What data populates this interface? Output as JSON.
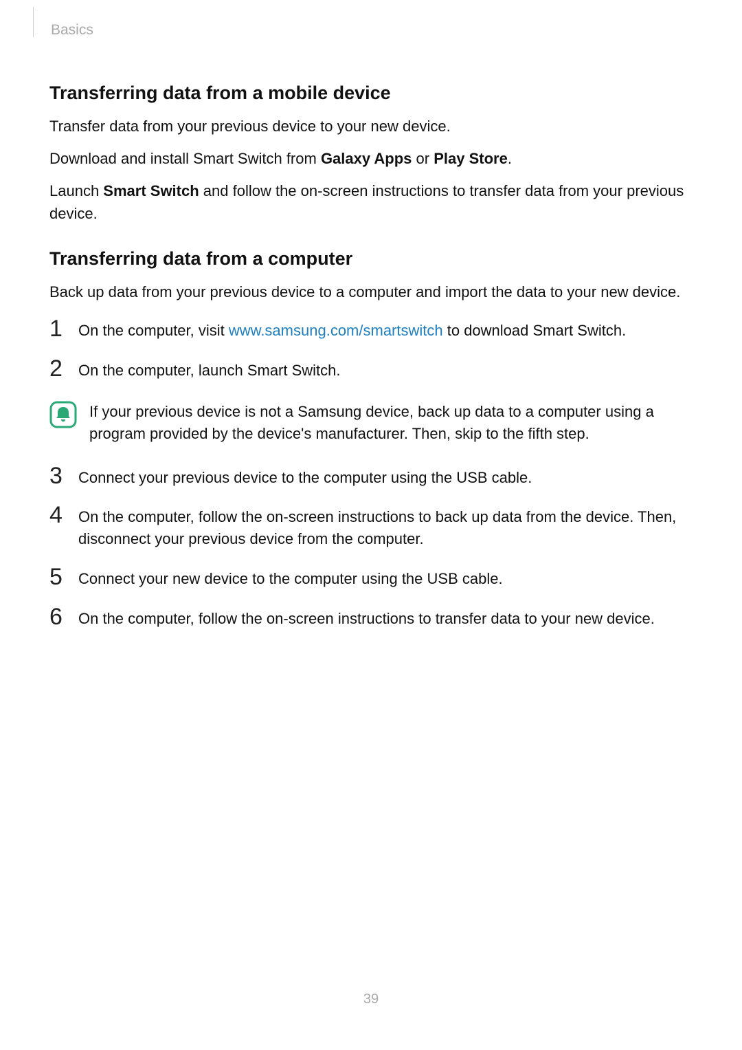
{
  "header": {
    "chapter": "Basics"
  },
  "section1": {
    "title": "Transferring data from a mobile device",
    "p1": "Transfer data from your previous device to your new device.",
    "p2_a": "Download and install Smart Switch from ",
    "p2_b": "Galaxy Apps",
    "p2_c": " or ",
    "p2_d": "Play Store",
    "p2_e": ".",
    "p3_a": "Launch ",
    "p3_b": "Smart Switch",
    "p3_c": " and follow the on-screen instructions to transfer data from your previous device."
  },
  "section2": {
    "title": "Transferring data from a computer",
    "intro": "Back up data from your previous device to a computer and import the data to your new device.",
    "step1": {
      "num": "1",
      "a": "On the computer, visit ",
      "link": "www.samsung.com/smartswitch",
      "b": " to download Smart Switch."
    },
    "step2": {
      "num": "2",
      "text": "On the computer, launch Smart Switch."
    },
    "note": "If your previous device is not a Samsung device, back up data to a computer using a program provided by the device's manufacturer. Then, skip to the fifth step.",
    "step3": {
      "num": "3",
      "text": "Connect your previous device to the computer using the USB cable."
    },
    "step4": {
      "num": "4",
      "text": "On the computer, follow the on-screen instructions to back up data from the device. Then, disconnect your previous device from the computer."
    },
    "step5": {
      "num": "5",
      "text": "Connect your new device to the computer using the USB cable."
    },
    "step6": {
      "num": "6",
      "text": "On the computer, follow the on-screen instructions to transfer data to your new device."
    }
  },
  "page_number": "39"
}
